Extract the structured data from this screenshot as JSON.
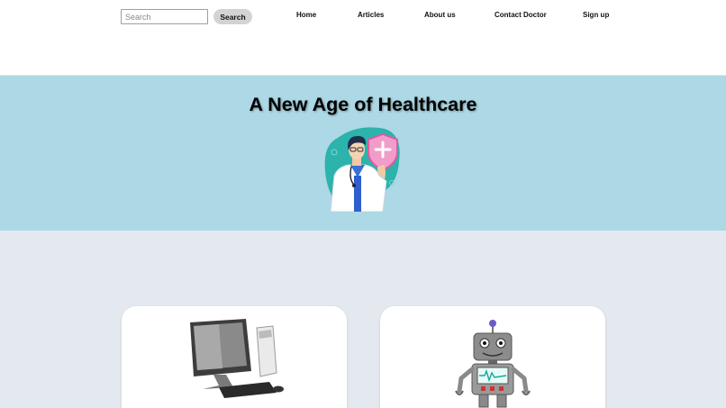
{
  "header": {
    "search": {
      "placeholder": "Search",
      "value": ""
    },
    "search_button": "Search",
    "nav": [
      {
        "label": "Home"
      },
      {
        "label": "Articles"
      },
      {
        "label": "About us"
      },
      {
        "label": "Contact Doctor"
      },
      {
        "label": "Sign up"
      }
    ]
  },
  "hero": {
    "title": "A New Age of Healthcare",
    "illustration": "doctor-with-shield-icon"
  },
  "cards": [
    {
      "image": "desktop-computer-icon"
    },
    {
      "image": "robot-icon"
    }
  ],
  "colors": {
    "hero_bg": "#add8e5",
    "page_bg": "#e3e9ef",
    "button_bg": "#d3d3d3",
    "card_bg": "#ffffff"
  }
}
